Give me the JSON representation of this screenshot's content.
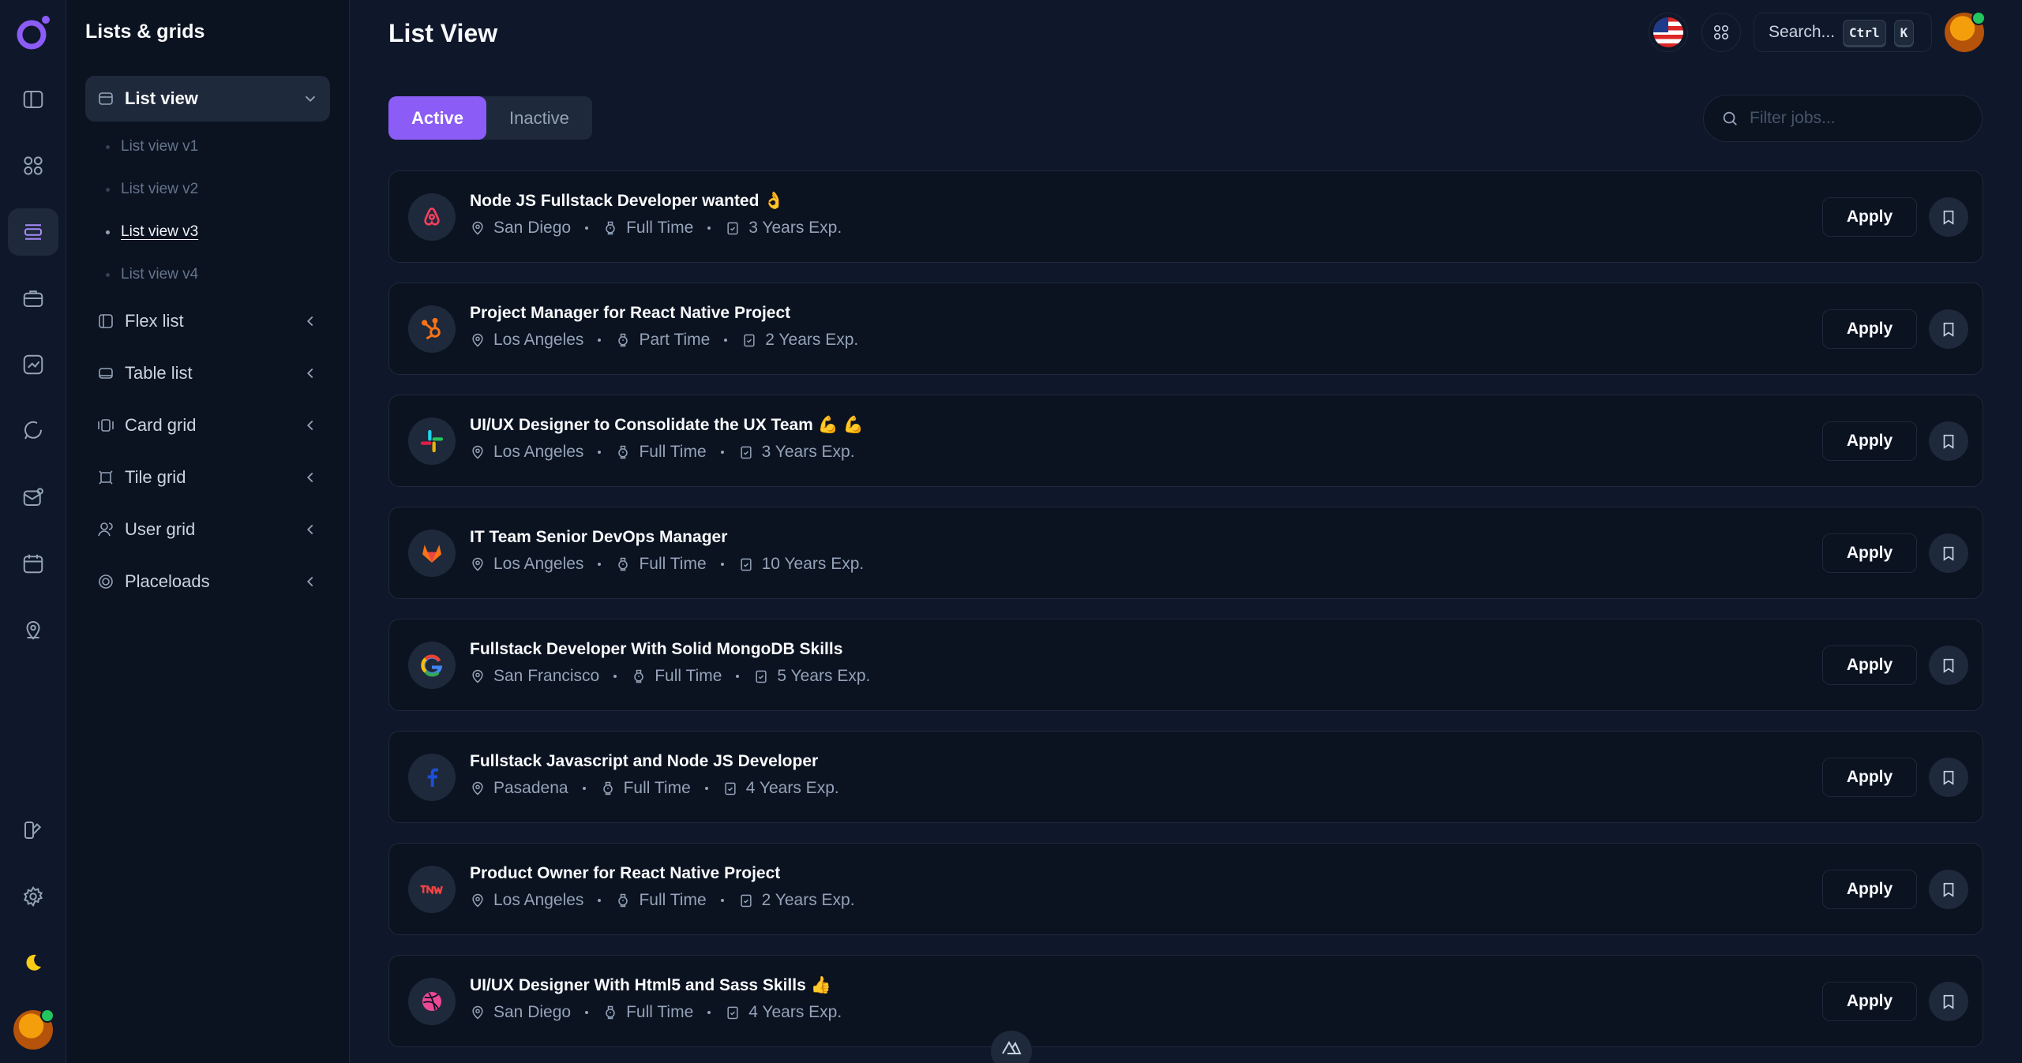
{
  "sidebar": {
    "title": "Lists & grids",
    "open_item": {
      "label": "List view",
      "icon": "list-view-icon"
    },
    "sub_items": [
      "List view v1",
      "List view v2",
      "List view v3",
      "List view v4"
    ],
    "current_sub": "List view v3",
    "items": [
      {
        "label": "Flex list",
        "icon": "flex-list-icon"
      },
      {
        "label": "Table list",
        "icon": "table-list-icon"
      },
      {
        "label": "Card grid",
        "icon": "card-grid-icon"
      },
      {
        "label": "Tile grid",
        "icon": "tile-grid-icon"
      },
      {
        "label": "User grid",
        "icon": "user-grid-icon"
      },
      {
        "label": "Placeloads",
        "icon": "placeloads-icon"
      }
    ]
  },
  "header": {
    "title": "List View",
    "search_label": "Search...",
    "kbd_ctrl": "Ctrl",
    "kbd_k": "K"
  },
  "tabs": [
    "Active",
    "Inactive"
  ],
  "filter": {
    "placeholder": "Filter jobs..."
  },
  "apply_label": "Apply",
  "jobs": [
    {
      "title": "Node JS Fullstack Developer wanted 👌",
      "location": "San Diego",
      "type": "Full Time",
      "exp": "3 Years Exp.",
      "logo": "airbnb-logo"
    },
    {
      "title": "Project Manager for React Native Project",
      "location": "Los Angeles",
      "type": "Part Time",
      "exp": "2 Years Exp.",
      "logo": "hubspot-logo"
    },
    {
      "title": "UI/UX Designer to Consolidate the UX Team 💪 💪",
      "location": "Los Angeles",
      "type": "Full Time",
      "exp": "3 Years Exp.",
      "logo": "slack-logo"
    },
    {
      "title": "IT Team Senior DevOps Manager",
      "location": "Los Angeles",
      "type": "Full Time",
      "exp": "10 Years Exp.",
      "logo": "gitlab-logo"
    },
    {
      "title": "Fullstack Developer With Solid MongoDB Skills",
      "location": "San Francisco",
      "type": "Full Time",
      "exp": "5 Years Exp.",
      "logo": "google-logo"
    },
    {
      "title": "Fullstack Javascript and Node JS Developer",
      "location": "Pasadena",
      "type": "Full Time",
      "exp": "4 Years Exp.",
      "logo": "facebook-logo"
    },
    {
      "title": "Product Owner for React Native Project",
      "location": "Los Angeles",
      "type": "Full Time",
      "exp": "2 Years Exp.",
      "logo": "tnw-logo"
    },
    {
      "title": "UI/UX Designer With Html5 and Sass Skills 👍",
      "location": "San Diego",
      "type": "Full Time",
      "exp": "4 Years Exp.",
      "logo": "dribbble-logo"
    }
  ],
  "colors": {
    "accent": "#8b5cf6",
    "background": "#0f172a",
    "card": "#0b1220",
    "border": "#1e293b"
  }
}
